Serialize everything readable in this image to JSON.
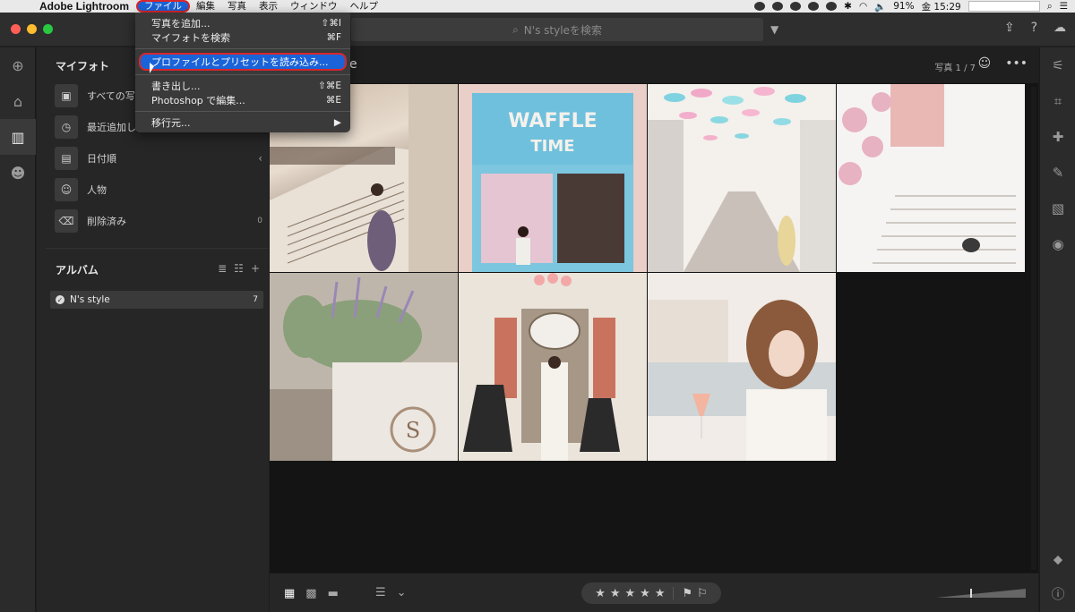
{
  "menubar": {
    "app_name": "Adobe Lightroom",
    "items": [
      "ファイル",
      "編集",
      "写真",
      "表示",
      "ウィンドウ",
      "ヘルプ"
    ],
    "battery": "91%",
    "clock": "金 15:29"
  },
  "file_menu": {
    "items": [
      {
        "label": "写真を追加...",
        "shortcut": "⇧⌘I"
      },
      {
        "label": "マイフォトを検索",
        "shortcut": "⌘F"
      },
      {
        "label": "プロファイルとプリセットを読み込み...",
        "shortcut": ""
      },
      {
        "label": "書き出し...",
        "shortcut": "⇧⌘E"
      },
      {
        "label": "Photoshop で編集...",
        "shortcut": "⌘E"
      },
      {
        "label": "移行元...",
        "shortcut": "▶"
      }
    ]
  },
  "search": {
    "placeholder": "N's styleを検索"
  },
  "sidebar": {
    "title": "マイフォト",
    "items": [
      {
        "label": "すべての写",
        "count": ""
      },
      {
        "label": "最近追加し",
        "count": ""
      },
      {
        "label": "日付順",
        "count": ""
      },
      {
        "label": "人物",
        "count": ""
      },
      {
        "label": "削除済み",
        "count": "0"
      }
    ],
    "albums_title": "アルバム",
    "album": {
      "name": "N's style",
      "count": "7"
    }
  },
  "main": {
    "album_title": "e",
    "photo_count": "写真 1 / 7"
  },
  "photos": [
    {
      "id": "palace-stairs"
    },
    {
      "id": "waffle-time-shop"
    },
    {
      "id": "umbrella-street"
    },
    {
      "id": "white-stairs-dog"
    },
    {
      "id": "lavender-planter"
    },
    {
      "id": "restaurant-facade"
    },
    {
      "id": "lakeside-wine"
    }
  ],
  "colors": {
    "menu_highlight": "#1a63d8",
    "annotation_red": "#d8262c"
  }
}
